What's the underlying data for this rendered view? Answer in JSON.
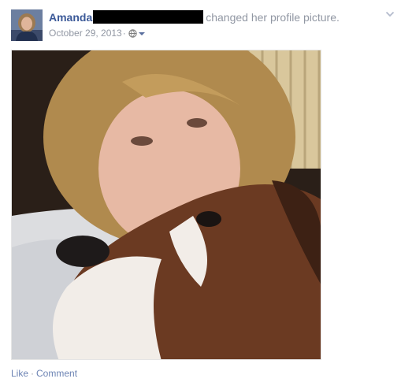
{
  "post": {
    "author": "Amanda",
    "action": "changed her profile picture.",
    "date": "October 29, 2013",
    "separator": "·",
    "audience_icon": "globe-icon",
    "options_icon": "chevron-down-icon"
  },
  "actions": {
    "like": "Like",
    "separator": "·",
    "comment": "Comment"
  },
  "colors": {
    "link": "#3b5998",
    "meta": "#9197a3",
    "action_link": "#6d84b4"
  }
}
